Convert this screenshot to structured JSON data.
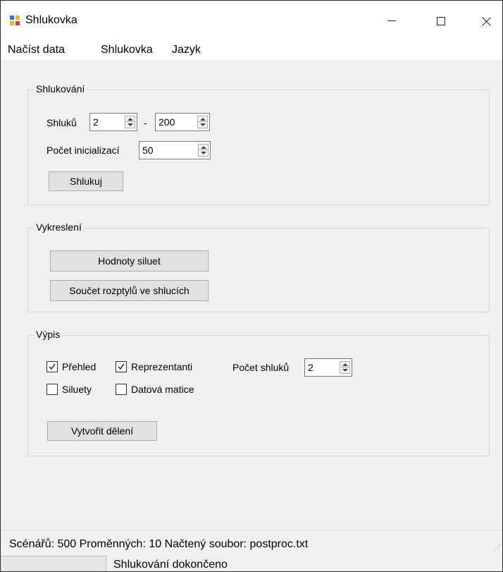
{
  "window": {
    "title": "Shlukovka"
  },
  "menu": [
    "Načíst data",
    "Shlukovka",
    "Jazyk"
  ],
  "clustering": {
    "label": "Shlukování",
    "clusters_label": "Shluků",
    "clusters_min": "2",
    "dash": "-",
    "clusters_max": "200",
    "init_label": "Počet inicializací",
    "init_value": "50",
    "button": "Shlukuj"
  },
  "plotting": {
    "label": "Vykreslení",
    "silhouette_button": "Hodnoty siluet",
    "scatter_button": "Součet rozptylů ve shlucích"
  },
  "output": {
    "label": "Výpis",
    "checkboxes": [
      {
        "label": "Přehled",
        "checked": true
      },
      {
        "label": "Reprezentanti",
        "checked": true
      },
      {
        "label": "Siluety",
        "checked": false
      },
      {
        "label": "Datová matice",
        "checked": false
      }
    ],
    "count_label": "Počet shluků",
    "count_value": "2",
    "button": "Vytvořit dělení"
  },
  "status": {
    "text": "Scénářů: 500  Proměnných: 10  Načtený soubor: postproc.txt",
    "message": "Shlukování dokončeno"
  }
}
